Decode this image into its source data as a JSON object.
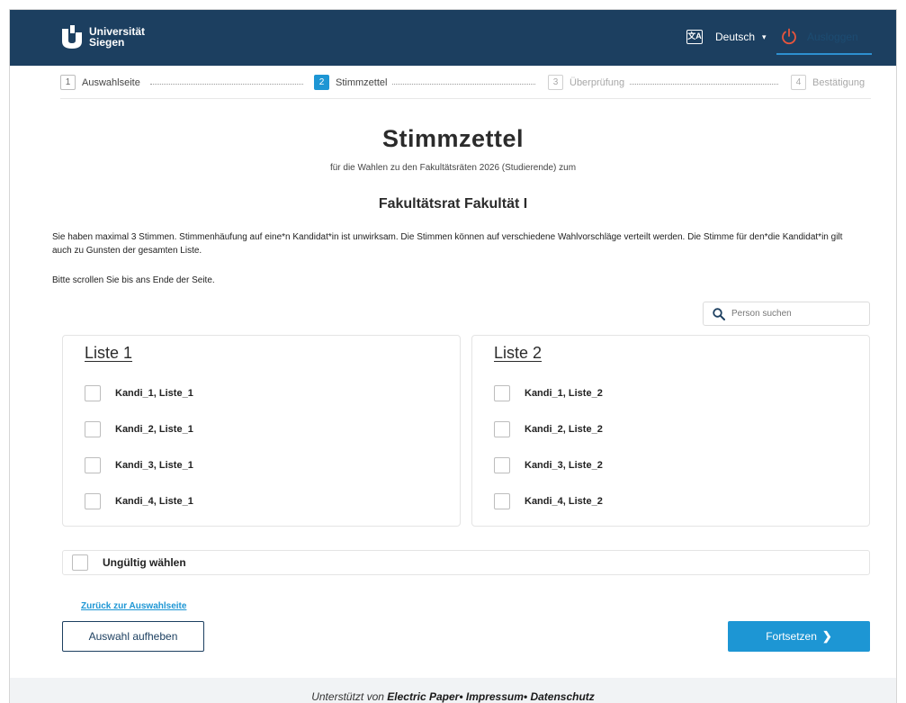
{
  "header": {
    "logo_line1": "Universität",
    "logo_line2": "Siegen",
    "language": "Deutsch",
    "language_caret": "▾",
    "logout": "Ausloggen"
  },
  "stepper": [
    {
      "num": "1",
      "label": "Auswahlseite"
    },
    {
      "num": "2",
      "label": "Stimmzettel"
    },
    {
      "num": "3",
      "label": "Überprüfung"
    },
    {
      "num": "4",
      "label": "Bestätigung"
    }
  ],
  "ballot": {
    "title": "Stimmzettel",
    "subtitle": "für die Wahlen zu den Fakultätsräten 2026 (Studierende) zum",
    "council": "Fakultätsrat Fakultät I",
    "info": "Sie haben maximal 3 Stimmen. Stimmenhäufung auf eine*n Kandidat*in ist unwirksam. Die Stimmen können auf verschiedene Wahlvorschläge verteilt werden. Die Stimme für den*die Kandidat*in gilt auch zu Gunsten der gesamten Liste.",
    "scroll_hint": "Bitte scrollen Sie bis ans Ende der Seite."
  },
  "search": {
    "placeholder": "Person suchen"
  },
  "lists": [
    {
      "title": "Liste 1",
      "candidates": [
        "Kandi_1, Liste_1",
        "Kandi_2, Liste_1",
        "Kandi_3, Liste_1",
        "Kandi_4, Liste_1"
      ]
    },
    {
      "title": "Liste 2",
      "candidates": [
        "Kandi_1, Liste_2",
        "Kandi_2, Liste_2",
        "Kandi_3, Liste_2",
        "Kandi_4, Liste_2"
      ]
    }
  ],
  "invalid_label": "Ungültig wählen",
  "actions": {
    "back_link": "Zurück zur Auswahlseite",
    "clear": "Auswahl aufheben",
    "continue": "Fortsetzen",
    "continue_icon": "❯"
  },
  "footer": {
    "prefix": "Unterstützt von",
    "brand": "Electric Paper",
    "sep": "•",
    "impressum": "Impressum",
    "datenschutz": "Datenschutz"
  },
  "colors": {
    "header_bg": "#1c3f60",
    "accent": "#1d96d4"
  },
  "icons": {
    "logo": "university-logo-icon",
    "language": "translate-icon",
    "logout": "power-icon",
    "search": "search-icon",
    "continue": "chevron-right-icon"
  }
}
